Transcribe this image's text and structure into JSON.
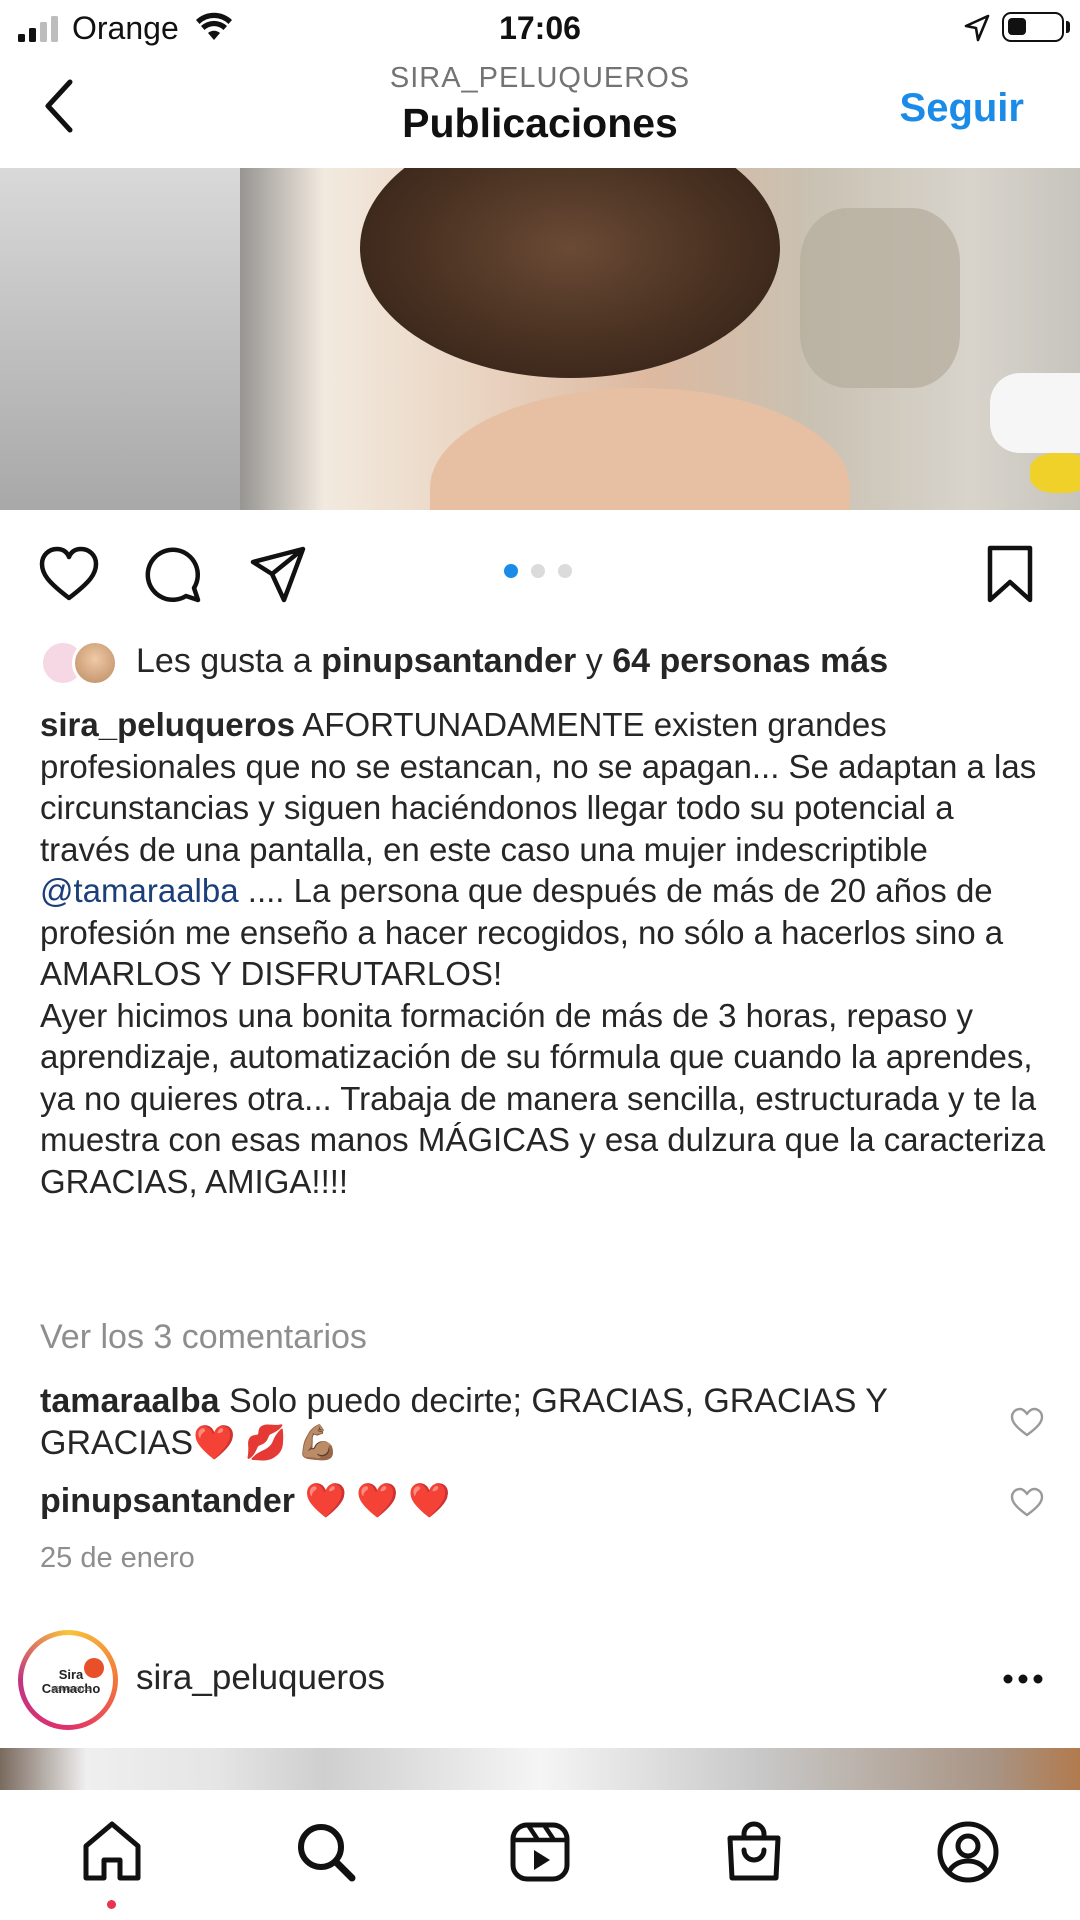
{
  "status_bar": {
    "carrier": "Orange",
    "time": "17:06"
  },
  "header": {
    "account": "SIRA_PELUQUEROS",
    "title": "Publicaciones",
    "follow_label": "Seguir"
  },
  "post": {
    "carousel": {
      "total": 3,
      "active": 1
    },
    "likes": {
      "prefix": "Les gusta a ",
      "user": "pinupsantander",
      "middle": " y ",
      "others": "64 personas más"
    },
    "caption": {
      "username": "sira_peluqueros",
      "text_before_mention": " AFORTUNADAMENTE existen grandes profesionales que no se estancan, no se apagan... Se adaptan a las circunstancias y siguen haciéndonos llegar todo su potencial a través de una pantalla, en este caso una mujer indescriptible ",
      "mention": "@tamaraalba",
      "text_after_mention": " .... La persona que después de más de 20 años de profesión me enseño a hacer recogidos, no sólo a hacerlos sino a AMARLOS Y DISFRUTARLOS!",
      "paragraph2": "Ayer hicimos una bonita formación de más de 3 horas, repaso y aprendizaje, automatización de su fórmula que cuando la aprendes, ya no quieres otra... Trabaja de manera sencilla, estructurada y te la muestra con esas manos MÁGICAS  y esa dulzura que la caracteriza",
      "paragraph3": "GRACIAS, AMIGA!!!!"
    },
    "view_comments": "Ver los 3 comentarios",
    "comments": [
      {
        "user": "tamaraalba",
        "text": " Solo puedo decirte; GRACIAS, GRACIAS Y GRACIAS❤️ 💋 💪🏽"
      },
      {
        "user": "pinupsantander",
        "text": " ❤️ ❤️ ❤️"
      }
    ],
    "date": "25 de enero"
  },
  "next_post": {
    "username": "sira_peluqueros",
    "avatar_logo": "Sira Camacho",
    "avatar_logo_sub": "peluqueros"
  },
  "tab_bar": {
    "items": [
      "home-icon",
      "search-icon",
      "reels-icon",
      "shop-icon",
      "profile-icon"
    ],
    "active": "home-icon"
  },
  "colors": {
    "accent": "#1a8ce8",
    "text": "#262626",
    "muted": "#8e8e8e",
    "mention": "#1c3f7a",
    "notification": "#e8344d"
  }
}
